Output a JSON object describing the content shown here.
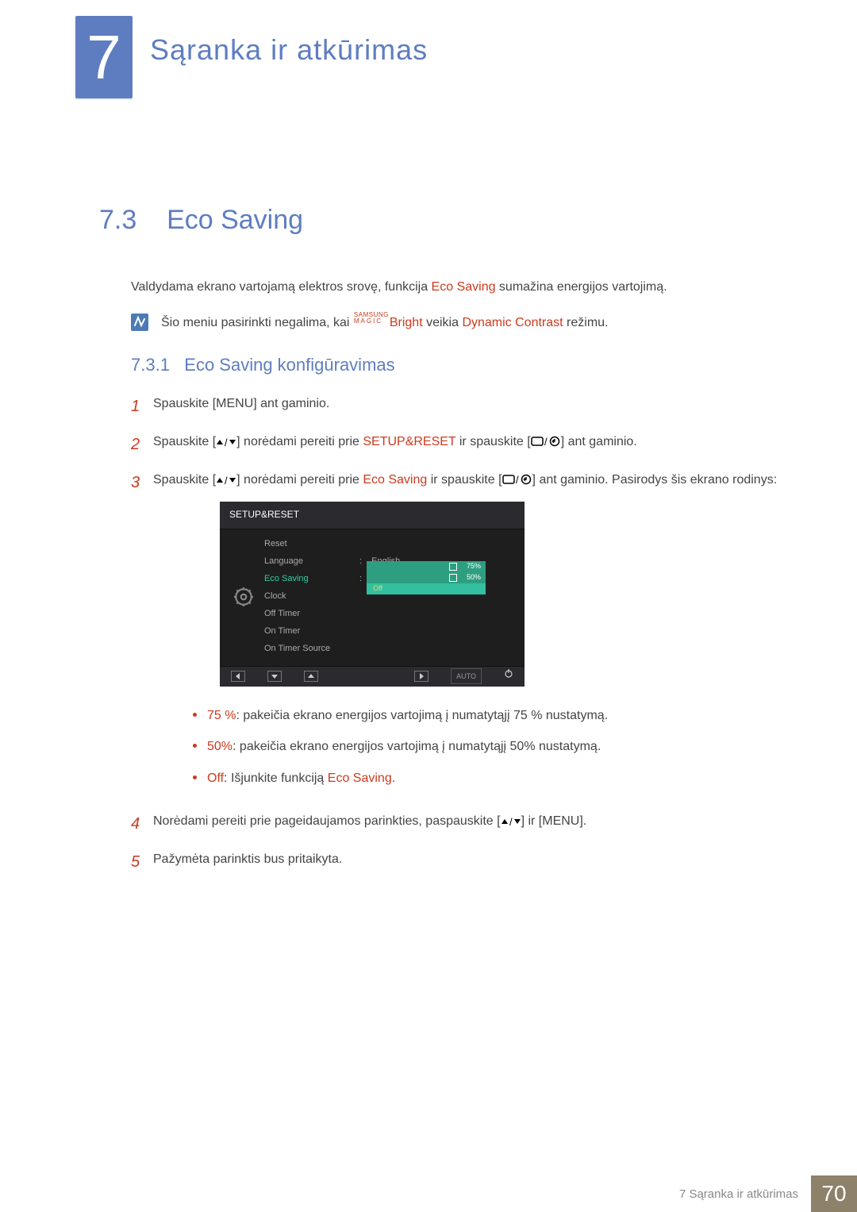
{
  "chapter": {
    "number": "7",
    "title": "Sąranka ir atkūrimas"
  },
  "section": {
    "number": "7.3",
    "title": "Eco Saving"
  },
  "intro": {
    "pre": "Valdydama ekrano vartojamą elektros srovę, funkcija ",
    "term": "Eco Saving",
    "post": " sumažina energijos vartojimą."
  },
  "note": {
    "pre": "Šio meniu pasirinkti negalima, kai ",
    "mb_top": "SAMSUNG",
    "mb_bot": "MAGIC",
    "mb_bright": "Bright",
    "mid": " veikia ",
    "dc": "Dynamic Contrast",
    "post": " režimu."
  },
  "subsection": {
    "number": "7.3.1",
    "title": "Eco Saving konfigūravimas"
  },
  "steps": {
    "s1": {
      "num": "1",
      "pre": "Spauskite [",
      "btn": "MENU",
      "post": "] ant gaminio."
    },
    "s2": {
      "num": "2",
      "pre": "Spauskite [",
      "mid1": "] norėdami pereiti prie ",
      "setup": "SETUP&RESET",
      "mid2": " ir spauskite [",
      "post": "] ant gaminio."
    },
    "s3": {
      "num": "3",
      "pre": "Spauskite [",
      "mid1": "] norėdami pereiti prie ",
      "eco": "Eco Saving",
      "mid2": " ir spauskite [",
      "post": "] ant gaminio. Pasirodys šis ekrano rodinys:"
    },
    "s4": {
      "num": "4",
      "pre": "Norėdami pereiti prie pageidaujamos parinkties, paspauskite [",
      "mid": "] ir [",
      "menu": "MENU",
      "post": "]."
    },
    "s5": {
      "num": "5",
      "text": "Pažymėta parinktis bus pritaikyta."
    }
  },
  "bullets": {
    "b1": {
      "label": "75 %",
      "text": ": pakeičia ekrano energijos vartojimą į numatytąjį 75 % nustatymą."
    },
    "b2": {
      "label": "50%",
      "text": ": pakeičia ekrano energijos vartojimą į numatytąjį 50% nustatymą."
    },
    "b3": {
      "label": "Off",
      "mid": ": Išjunkite funkciją ",
      "eco": "Eco Saving",
      "post": "."
    }
  },
  "osd": {
    "title": "SETUP&RESET",
    "rows": {
      "reset": "Reset",
      "language": "Language",
      "language_val": "English",
      "eco": "Eco Saving",
      "clock": "Clock",
      "offtimer": "Off Timer",
      "ontimer": "On Timer",
      "ontimersrc": "On Timer Source"
    },
    "eco_opts": {
      "p75": "75%",
      "p50": "50%",
      "off": "Off"
    },
    "auto": "AUTO"
  },
  "footer": {
    "text": "7 Sąranka ir atkūrimas",
    "page": "70"
  }
}
